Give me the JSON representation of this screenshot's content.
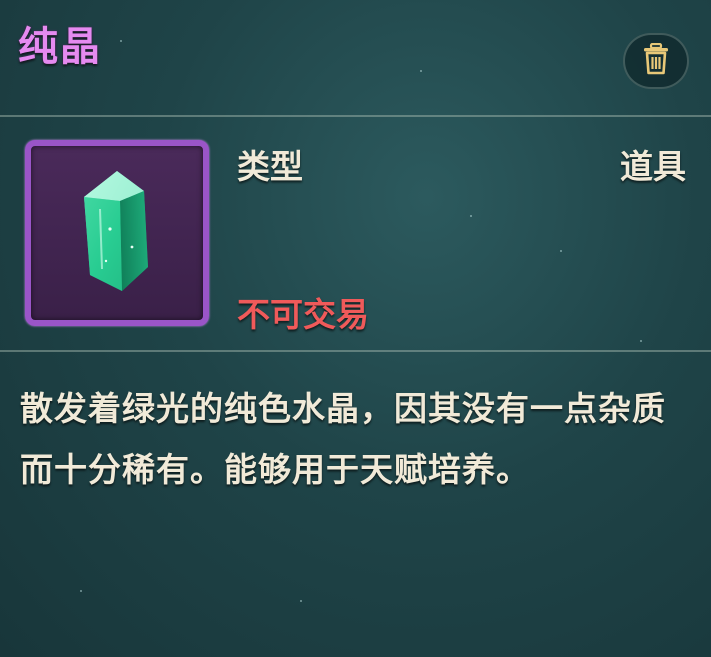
{
  "item": {
    "name": "纯晶",
    "icon": "green-crystal-icon",
    "type_label": "类型",
    "type_value": "道具",
    "trade_status": "不可交易",
    "description": "散发着绿光的纯色水晶，因其没有一点杂质而十分稀有。能够用于天赋培养。"
  },
  "actions": {
    "delete_icon": "trash-icon"
  },
  "colors": {
    "title": "#e58af0",
    "frame_rarity": "#9a55c8",
    "untradeable": "#f05a5a",
    "text": "#f1ead8",
    "background": "#1f4448"
  }
}
